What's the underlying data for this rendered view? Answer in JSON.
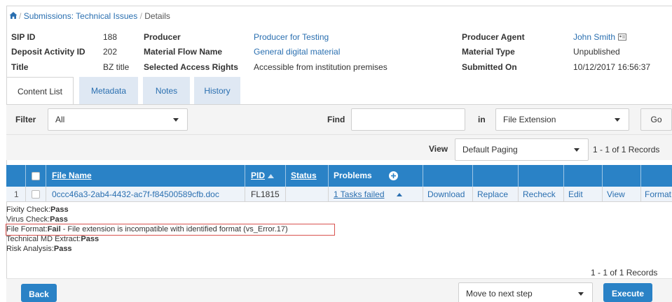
{
  "breadcrumb": {
    "items": [
      "Submissions: Technical Issues",
      "Details"
    ],
    "separator": "/"
  },
  "details": {
    "sip_id_label": "SIP ID",
    "sip_id_value": "188",
    "deposit_label": "Deposit Activity ID",
    "deposit_value": "202",
    "title_label": "Title",
    "title_value": "BZ title",
    "producer_label": "Producer",
    "producer_value": "Producer for Testing",
    "flow_label": "Material Flow Name",
    "flow_value": "General digital material",
    "rights_label": "Selected Access Rights",
    "rights_value": "Accessible from institution premises",
    "agent_label": "Producer Agent",
    "agent_value": "John Smith",
    "type_label": "Material Type",
    "type_value": "Unpublished",
    "submitted_label": "Submitted On",
    "submitted_value": "10/12/2017 16:56:37"
  },
  "tabs": [
    {
      "label": "Content List",
      "active": true
    },
    {
      "label": "Metadata",
      "active": false
    },
    {
      "label": "Notes",
      "active": false
    },
    {
      "label": "History",
      "active": false
    }
  ],
  "toolbar": {
    "filter_label": "Filter",
    "filter_value": "All",
    "find_label": "Find",
    "find_value": "",
    "in_label": "in",
    "in_value": "File Extension",
    "go_label": "Go",
    "view_label": "View",
    "view_value": "Default Paging",
    "records": "1 - 1 of 1 Records"
  },
  "table": {
    "headers": {
      "file_name": "File Name",
      "pid": "PID",
      "status": "Status",
      "problems": "Problems"
    },
    "row": {
      "index": "1",
      "file_name": "0ccc46a3-2ab4-4432-ac7f-f84500589cfb.doc",
      "pid": "FL1815",
      "status": "",
      "problems": "1 Tasks failed",
      "actions": [
        "Download",
        "Replace",
        "Recheck",
        "Edit",
        "View",
        "Format"
      ]
    }
  },
  "problems_detail": [
    {
      "label": "Fixity Check:",
      "result": "Pass",
      "note": ""
    },
    {
      "label": "Virus Check:",
      "result": "Pass",
      "note": ""
    },
    {
      "label": "File Format:",
      "result": "Fail",
      "note": " - File extension is incompatible with identified format (vs_Error.17)"
    },
    {
      "label": "Technical MD Extract:",
      "result": "Pass",
      "note": ""
    },
    {
      "label": "Risk Analysis:",
      "result": "Pass",
      "note": ""
    }
  ],
  "footer": {
    "records": "1 - 1 of 1 Records",
    "back_label": "Back",
    "step_value": "Move to next step",
    "execute_label": "Execute"
  },
  "colors": {
    "accent": "#2a82c6",
    "link": "#2a6fb0",
    "error_outline": "#d9534f"
  }
}
